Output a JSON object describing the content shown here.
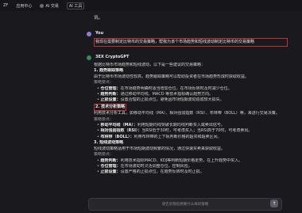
{
  "topbar": {
    "tab1": "ZF",
    "tab2": "应用中心",
    "tab3": "AI 交易",
    "tab4": "AI 工具"
  },
  "previous": {
    "text": "讯。"
  },
  "user": {
    "name": "You",
    "message": "我现在需要制定比特币的交易策略，帮我为该个市场趋势和短线波动制定比特币的交易策略"
  },
  "bot": {
    "name": "3EX CryptoGPT",
    "lines": [
      {
        "type": "text",
        "text": "根据比特币市场趋势和短线波动，以下是一些建议的交易策略："
      },
      {
        "type": "heading",
        "text": "1. 趋势跟踪策略"
      },
      {
        "type": "text",
        "text": "由于比特币市场波动性较高，趋势跟踪策略可以帮助投资者在市场趋势形成时获取收益。"
      },
      {
        "type": "sub",
        "text": "策略要点："
      },
      {
        "type": "bullet",
        "bold": "仓位管理：",
        "text": "在市场趋势明确时适当增加仓位，在市场反转时及时减少仓位。"
      },
      {
        "type": "bullet",
        "bold": "趋势判断：",
        "text": "通过移动平均线、MACD 等技术指标确认趋势方向。"
      },
      {
        "type": "bullet",
        "bold": "止损设置：",
        "text": "设置合理的止损点位，避免因市场短期波动造成较大损失。"
      },
      {
        "type": "heading",
        "text": "2. 技术分析策略",
        "boxed": true
      },
      {
        "type": "text",
        "text": "利用技术分析工具，如移动平均线（MA）、相对强弱指数（RSI）、布林带（BOLL）等，来进行交易决策。"
      },
      {
        "type": "sub",
        "text": "策略要点："
      },
      {
        "type": "bullet",
        "bold": "移动平均线（MA）：",
        "text": "利用短期均线突破长期均线判断买入或卖出信号。"
      },
      {
        "type": "bullet",
        "bold": "相对强弱指数（RSI）：",
        "text": "当RSI低于30时，可考虑买入；当RSI高于70时，可考虑卖出。"
      },
      {
        "type": "bullet",
        "bold": "布林带（BOLL）：",
        "text": "利用布林带的上下轨判断价格的超买和超卖区间。"
      },
      {
        "type": "heading",
        "text": "3. 短线波动策略"
      },
      {
        "type": "text",
        "text": "短线波动策略适用于市场短期波动频繁的情况，通过快速买卖来获取收益。"
      },
      {
        "type": "sub",
        "text": "策略要点："
      },
      {
        "type": "bullet",
        "bold": "趋势判断：",
        "text": "利用技术指标MACD、KDJ等判断短期价格走势，在上升趋势中买入。"
      },
      {
        "type": "bullet",
        "bold": "仓位管理：",
        "text": "在市场波动时灵活调整仓位，控制风险。"
      },
      {
        "type": "bullet",
        "bold": "止损设置：",
        "text": "设置严格的止损点位，在趋势反转时及时止损。"
      }
    ]
  },
  "input": {
    "placeholder": "请告诉我您想要什么样的策略"
  },
  "send": {
    "icon": "↑"
  }
}
